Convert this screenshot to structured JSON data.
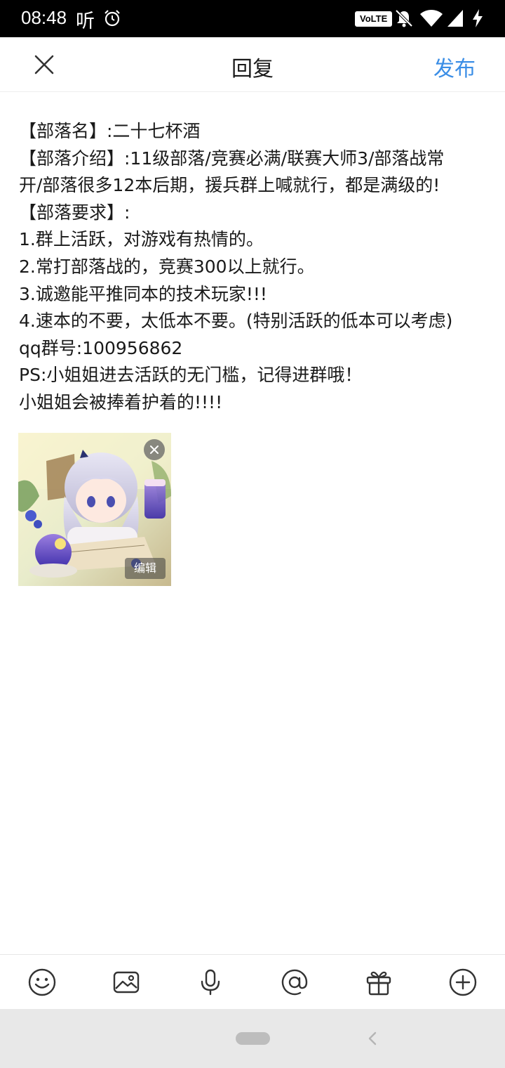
{
  "status_bar": {
    "time": "08:48",
    "app_icon_text": "听",
    "volte_badge": "VoLTE",
    "icons": [
      "alarm-icon",
      "mute-icon",
      "wifi-icon",
      "signal-icon",
      "charging-icon"
    ]
  },
  "header": {
    "title": "回复",
    "publish_label": "发布",
    "close_icon": "close-icon"
  },
  "post": {
    "lines": [
      "【部落名】:二十七杯酒",
      "【部落介绍】:11级部落/竞赛必满/联赛大师3/部落战常",
      "开/部落很多12本后期，援兵群上喊就行，都是满级的!",
      "【部落要求】:",
      "1.群上活跃，对游戏有热情的。",
      "2.常打部落战的，竞赛300以上就行。",
      "3.诚邀能平推同本的技术玩家!!!",
      "4.速本的不要，太低本不要。(特别活跃的低本可以考虑)",
      "qq群号:100956862",
      "PS:小姐姐进去活跃的无门槛，记得进群哦！",
      "小姐姐会被捧着护着的!!!!"
    ]
  },
  "attachment": {
    "edit_label": "编辑",
    "remove_icon": "close-circle-icon"
  },
  "toolbar": {
    "items": [
      "emoji-icon",
      "image-icon",
      "microphone-icon",
      "mention-icon",
      "gift-icon",
      "add-icon"
    ]
  },
  "colors": {
    "accent": "#3b8ee6",
    "status_bar": "#000000",
    "nav_bar": "#e8e8e8"
  }
}
